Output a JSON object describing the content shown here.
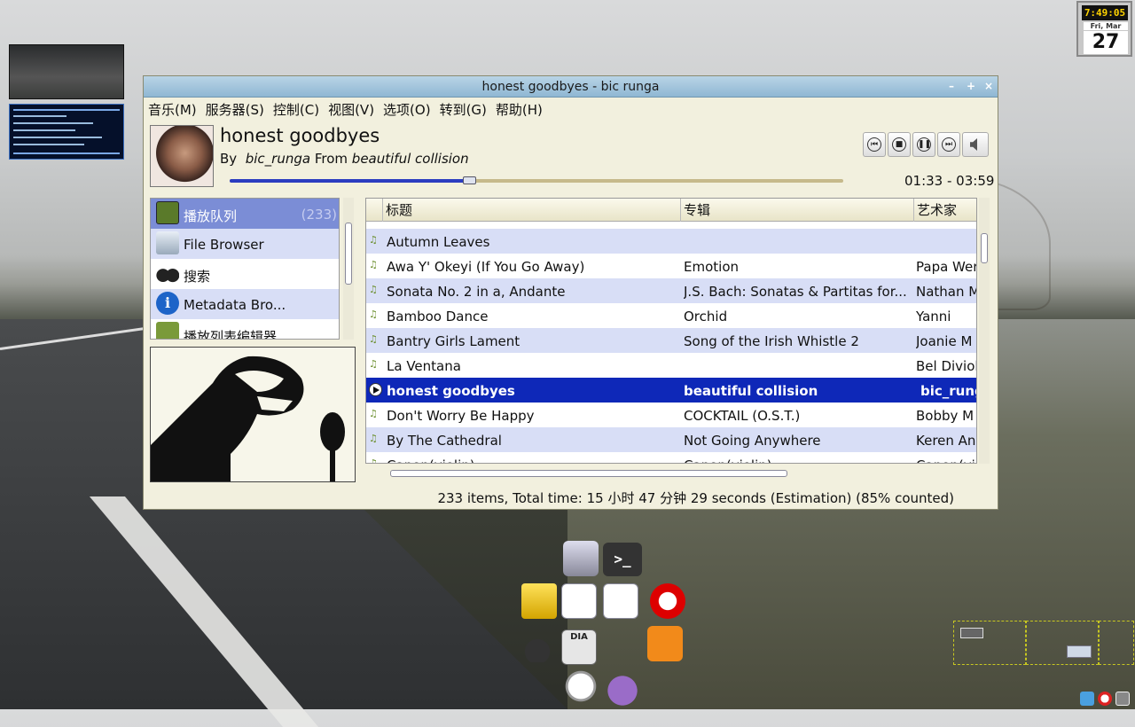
{
  "clock": {
    "time": "7:49:05",
    "day": "Fri, Mar",
    "date": "27"
  },
  "window": {
    "title": "honest goodbyes -  bic runga",
    "menu": [
      "音乐(M)",
      "服务器(S)",
      "控制(C)",
      "视图(V)",
      "选项(O)",
      "转到(G)",
      "帮助(H)"
    ],
    "track": {
      "title": "honest goodbyes",
      "by_label": "By",
      "artist": "bic_runga",
      "from_label": "From",
      "album": "beautiful collision",
      "timer": "01:33 - 03:59",
      "progress": 0.39
    },
    "sidebar": [
      {
        "label": "播放队列",
        "count": "(233)",
        "icon": "playlist-icon"
      },
      {
        "label": "File Browser",
        "icon": "drive-icon"
      },
      {
        "label": "搜索",
        "icon": "binoculars-icon"
      },
      {
        "label": "Metadata Bro...",
        "icon": "info-icon"
      },
      {
        "label": "播放列表编辑器",
        "icon": "playlist-editor-icon"
      }
    ],
    "columns": [
      "标题",
      "专辑",
      "艺术家"
    ],
    "rows": [
      {
        "title": "Autumn Leaves",
        "album": "",
        "artist": ""
      },
      {
        "title": "Awa Y' Okeyi (If You Go Away)",
        "album": "Emotion",
        "artist": "Papa Wer"
      },
      {
        "title": "Sonata No. 2 in a, Andante",
        "album": "J.S. Bach:  Sonatas & Partitas for...",
        "artist": "Nathan M"
      },
      {
        "title": "Bamboo Dance",
        "album": "Orchid",
        "artist": "Yanni"
      },
      {
        "title": "Bantry Girls Lament",
        "album": "Song of the Irish Whistle 2",
        "artist": "Joanie M"
      },
      {
        "title": "La Ventana",
        "album": "",
        "artist": "Bel Diviol"
      },
      {
        "title": "honest goodbyes",
        "album": "beautiful collision",
        "artist": "bic_rung"
      },
      {
        "title": "Don't Worry Be Happy",
        "album": "COCKTAIL (O.S.T.)",
        "artist": "Bobby M"
      },
      {
        "title": "By The Cathedral",
        "album": "Not Going Anywhere",
        "artist": "Keren An"
      },
      {
        "title": "Canon(violin)",
        "album": "Canon(violin)",
        "artist": "Canon(vi"
      }
    ],
    "status": "233 items,  Total time: 15 小时 47 分钟 29 seconds (Estimation) (85% counted)"
  },
  "dock_icons": [
    "file-manager-icon",
    "terminal-icon",
    "lock-icon",
    "editor-icon",
    "spreadsheet-icon",
    "opera-icon",
    "headphones-icon",
    "dia-icon",
    "rss-icon",
    "alarm-clock-icon",
    "pidgin-icon"
  ],
  "dia_label": "DIA",
  "terminal_label": ">_"
}
